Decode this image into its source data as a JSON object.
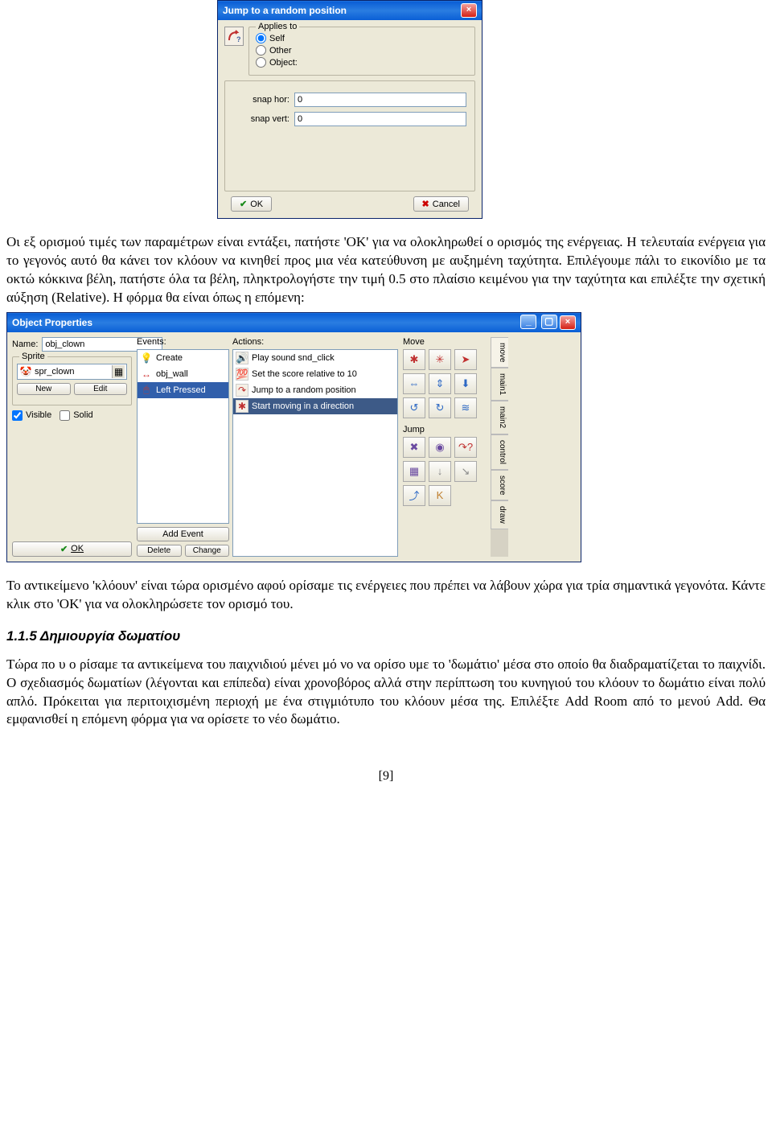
{
  "dialog1": {
    "title": "Jump to a random position",
    "applies_legend": "Applies to",
    "radio_self": "Self",
    "radio_other": "Other",
    "radio_object": "Object:",
    "snap_hor_label": "snap hor:",
    "snap_hor_value": "0",
    "snap_vert_label": "snap vert:",
    "snap_vert_value": "0",
    "ok": "OK",
    "cancel": "Cancel"
  },
  "para1": "Οι εξ ορισμού τιμές των παραμέτρων είναι εντάξει, πατήστε 'OK' για να ολοκληρωθεί ο ορισμός της ενέργειας. Η τελευταία ενέργεια για το γεγονός αυτό θα κάνει τον κλόουν να κινηθεί προς μια νέα κατεύθυνση με αυξημένη ταχύτητα. Επιλέγουμε πάλι το εικονίδιο με τα οκτώ κόκκινα βέλη, πατήστε όλα τα βέλη, πληκτρολογήστε την τιμή 0.5 στο πλαίσιο κειμένου για την ταχύτητα και επιλέξτε την σχετική αύξηση (Relative). Η φόρμα θα είναι όπως η επόμενη:",
  "dialog2": {
    "title": "Object Properties",
    "name_label": "Name:",
    "name_value": "obj_clown",
    "sprite_label": "Sprite",
    "sprite_value": "spr_clown",
    "btn_new": "New",
    "btn_edit": "Edit",
    "cb_visible": "Visible",
    "cb_solid": "Solid",
    "ok": "OK",
    "events_label": "Events:",
    "events": [
      {
        "label": "Create",
        "color": "#d8c040"
      },
      {
        "label": "obj_wall",
        "color": "#d03030"
      },
      {
        "label": "Left Pressed",
        "color": "#b04040",
        "selected": true
      }
    ],
    "add_event": "Add Event",
    "delete": "Delete",
    "change": "Change",
    "actions_label": "Actions:",
    "actions": [
      "Play sound snd_click",
      "Set the score relative to 10",
      "Jump to a random position",
      "Start moving in a direction"
    ],
    "move_heading": "Move",
    "jump_heading": "Jump",
    "tabs": [
      "move",
      "main1",
      "main2",
      "control",
      "score",
      "draw"
    ]
  },
  "para2": "Το αντικείμενο 'κλόουν' είναι τώρα ορισμένο αφού ορίσαμε τις ενέργειες που πρέπει να λάβουν χώρα για τρία σημαντικά γεγονότα. Κάντε κλικ στο 'OK' για να ολοκληρώσετε τον ορισμό του.",
  "heading": "1.1.5 Δημιουργία δωματίου",
  "para3": "Τώρα πο υ ο ρίσαμε τα αντικείμενα του παιχνιδιού μένει μό νο να ορίσο υμε το 'δωμάτιο' μέσα στο οποίο θα διαδραματίζεται το παιχνίδι. Ο σχεδιασμός δωματίων (λέγονται και επίπεδα) είναι χρονοβόρος αλλά στην περίπτωση του κυνηγιού του κλόουν το δωμάτιο είναι πολύ απλό. Πρόκειται για περιτοιχισμένη περιοχή με ένα στιγμιότυπο του κλόουν μέσα της. Επιλέξτε Add Room από το μενού Add. Θα εμφανισθεί η επόμενη φόρμα για να ορίσετε το νέο δωμάτιο.",
  "page_num": "[9]"
}
